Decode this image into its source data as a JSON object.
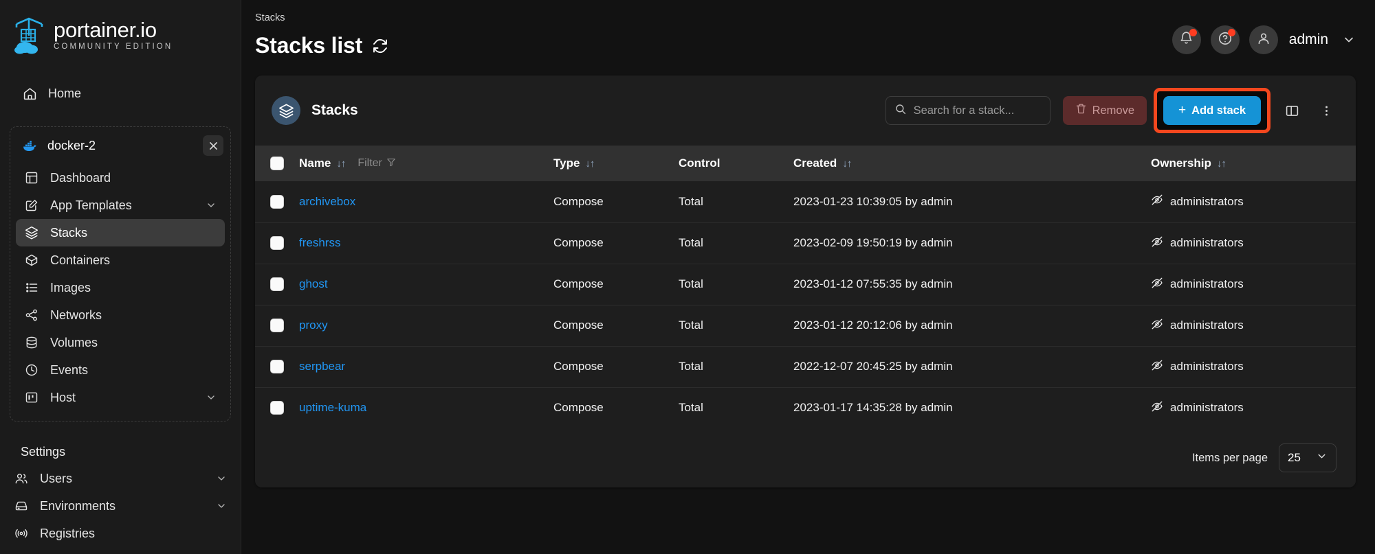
{
  "brand": {
    "name": "portainer.io",
    "edition": "COMMUNITY EDITION",
    "logo_icon": "portainer-crane-logo"
  },
  "sidebar": {
    "collapse_icon": "chevron-double-left-icon",
    "home": {
      "label": "Home",
      "icon": "home-icon"
    },
    "environment": {
      "name": "docker-2",
      "icon": "docker-whale-icon",
      "close_icon": "close-icon"
    },
    "items": [
      {
        "label": "Dashboard",
        "icon": "dashboard-icon",
        "expandable": false,
        "active": false
      },
      {
        "label": "App Templates",
        "icon": "edit-square-icon",
        "expandable": true,
        "active": false
      },
      {
        "label": "Stacks",
        "icon": "layers-icon",
        "expandable": false,
        "active": true
      },
      {
        "label": "Containers",
        "icon": "cube-icon",
        "expandable": false,
        "active": false
      },
      {
        "label": "Images",
        "icon": "list-icon",
        "expandable": false,
        "active": false
      },
      {
        "label": "Networks",
        "icon": "share-nodes-icon",
        "expandable": false,
        "active": false
      },
      {
        "label": "Volumes",
        "icon": "database-icon",
        "expandable": false,
        "active": false
      },
      {
        "label": "Events",
        "icon": "clock-icon",
        "expandable": false,
        "active": false
      },
      {
        "label": "Host",
        "icon": "server-panel-icon",
        "expandable": true,
        "active": false
      }
    ],
    "settings_title": "Settings",
    "settings_items": [
      {
        "label": "Users",
        "icon": "users-icon",
        "expandable": true
      },
      {
        "label": "Environments",
        "icon": "hard-drive-icon",
        "expandable": true
      },
      {
        "label": "Registries",
        "icon": "radio-icon",
        "expandable": false
      }
    ]
  },
  "header": {
    "breadcrumb": "Stacks",
    "title": "Stacks list",
    "refresh_icon": "refresh-icon",
    "notifications": {
      "icon": "bell-icon",
      "has_badge": true
    },
    "help": {
      "icon": "question-circle-icon",
      "has_badge": true
    },
    "user": {
      "name": "admin",
      "avatar_icon": "user-icon",
      "chevron_icon": "chevron-down-icon"
    }
  },
  "card": {
    "icon": "layers-icon",
    "title": "Stacks",
    "search": {
      "placeholder": "Search for a stack...",
      "value": "",
      "icon": "search-icon"
    },
    "remove_button": {
      "label": "Remove",
      "icon": "trash-icon"
    },
    "add_button": {
      "label": "Add stack",
      "plus": "+"
    },
    "columns_toggle_icon": "columns-layout-icon",
    "more_menu_icon": "kebab-menu-icon"
  },
  "table": {
    "columns": [
      {
        "key": "name",
        "label": "Name",
        "sortable": true,
        "filter_label": "Filter",
        "filter_icon": "funnel-icon"
      },
      {
        "key": "type",
        "label": "Type",
        "sortable": true
      },
      {
        "key": "control",
        "label": "Control",
        "sortable": false
      },
      {
        "key": "created",
        "label": "Created",
        "sortable": true
      },
      {
        "key": "ownership",
        "label": "Ownership",
        "sortable": true
      }
    ],
    "sort_icon": "sort-updown-icon",
    "ownership_icon": "eye-off-icon",
    "rows": [
      {
        "name": "archivebox",
        "type": "Compose",
        "control": "Total",
        "created": "2023-01-23 10:39:05 by admin",
        "ownership": "administrators"
      },
      {
        "name": "freshrss",
        "type": "Compose",
        "control": "Total",
        "created": "2023-02-09 19:50:19 by admin",
        "ownership": "administrators"
      },
      {
        "name": "ghost",
        "type": "Compose",
        "control": "Total",
        "created": "2023-01-12 07:55:35 by admin",
        "ownership": "administrators"
      },
      {
        "name": "proxy",
        "type": "Compose",
        "control": "Total",
        "created": "2023-01-12 20:12:06 by admin",
        "ownership": "administrators"
      },
      {
        "name": "serpbear",
        "type": "Compose",
        "control": "Total",
        "created": "2022-12-07 20:45:25 by admin",
        "ownership": "administrators"
      },
      {
        "name": "uptime-kuma",
        "type": "Compose",
        "control": "Total",
        "created": "2023-01-17 14:35:28 by admin",
        "ownership": "administrators"
      }
    ]
  },
  "footer": {
    "items_per_page_label": "Items per page",
    "items_per_page_value": "25",
    "chevron_icon": "chevron-down-icon"
  },
  "annotation": {
    "highlight_color": "#f4471e",
    "arrow_icon": "arrow-up-right-annotation",
    "target": "Add stack"
  },
  "colors": {
    "accent_blue": "#1593d6",
    "link_blue": "#2196f3",
    "sidebar_bg": "#1b1b1b",
    "card_bg": "#1e1e1e",
    "page_bg": "#121212",
    "annotation": "#f4471e"
  }
}
